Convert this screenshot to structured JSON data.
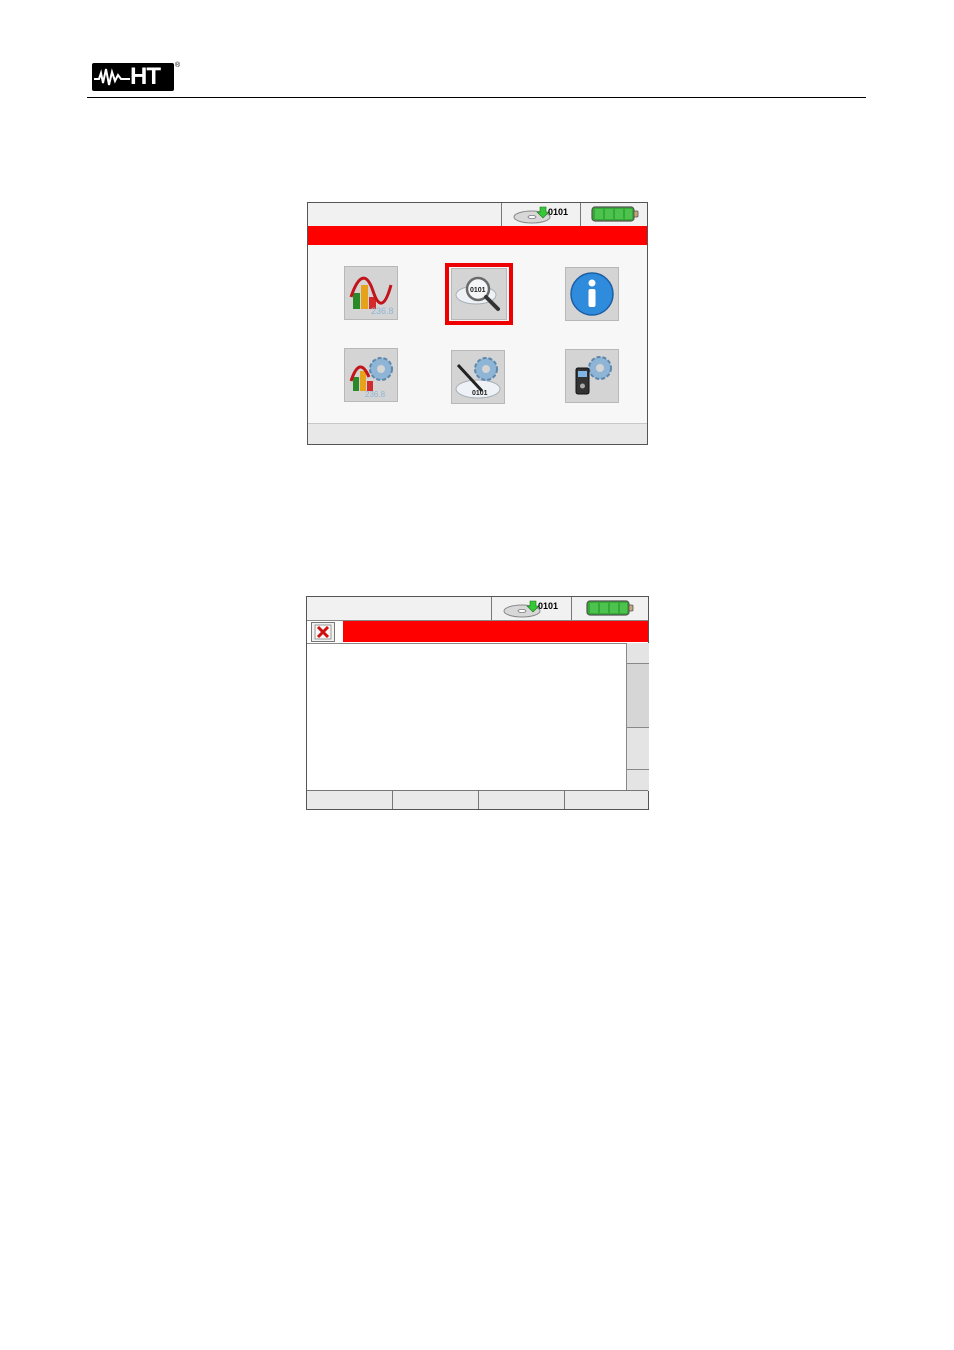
{
  "header": {
    "logo_text": "HT",
    "logo_mark": "®"
  },
  "screen1": {
    "status": {
      "memory_icon": "cd-0101-icon",
      "memory_label": "0101",
      "battery_icon": "battery-full-icon"
    },
    "menu_icons": [
      {
        "name": "analysis-icon",
        "selected": false
      },
      {
        "name": "recall-data-icon",
        "label": "0101",
        "selected": true
      },
      {
        "name": "info-icon",
        "selected": false
      },
      {
        "name": "analysis-settings-icon",
        "selected": false
      },
      {
        "name": "recording-settings-icon",
        "label": "0101",
        "selected": false
      },
      {
        "name": "instrument-settings-icon",
        "selected": false
      }
    ],
    "colors": {
      "accent": "#ff0000"
    }
  },
  "screen2": {
    "status": {
      "memory_icon": "cd-0101-icon",
      "memory_label": "0101",
      "battery_icon": "battery-full-icon"
    },
    "close_icon": "close-x-icon",
    "softkey_count": 4
  }
}
